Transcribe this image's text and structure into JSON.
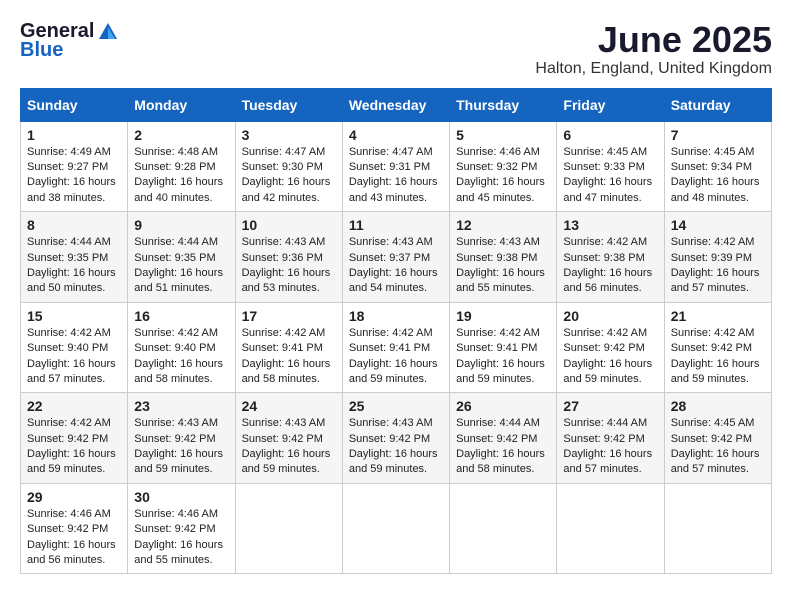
{
  "logo": {
    "general": "General",
    "blue": "Blue"
  },
  "title": "June 2025",
  "location": "Halton, England, United Kingdom",
  "headers": [
    "Sunday",
    "Monday",
    "Tuesday",
    "Wednesday",
    "Thursday",
    "Friday",
    "Saturday"
  ],
  "weeks": [
    [
      {
        "day": "1",
        "sunrise": "Sunrise: 4:49 AM",
        "sunset": "Sunset: 9:27 PM",
        "daylight": "Daylight: 16 hours and 38 minutes."
      },
      {
        "day": "2",
        "sunrise": "Sunrise: 4:48 AM",
        "sunset": "Sunset: 9:28 PM",
        "daylight": "Daylight: 16 hours and 40 minutes."
      },
      {
        "day": "3",
        "sunrise": "Sunrise: 4:47 AM",
        "sunset": "Sunset: 9:30 PM",
        "daylight": "Daylight: 16 hours and 42 minutes."
      },
      {
        "day": "4",
        "sunrise": "Sunrise: 4:47 AM",
        "sunset": "Sunset: 9:31 PM",
        "daylight": "Daylight: 16 hours and 43 minutes."
      },
      {
        "day": "5",
        "sunrise": "Sunrise: 4:46 AM",
        "sunset": "Sunset: 9:32 PM",
        "daylight": "Daylight: 16 hours and 45 minutes."
      },
      {
        "day": "6",
        "sunrise": "Sunrise: 4:45 AM",
        "sunset": "Sunset: 9:33 PM",
        "daylight": "Daylight: 16 hours and 47 minutes."
      },
      {
        "day": "7",
        "sunrise": "Sunrise: 4:45 AM",
        "sunset": "Sunset: 9:34 PM",
        "daylight": "Daylight: 16 hours and 48 minutes."
      }
    ],
    [
      {
        "day": "8",
        "sunrise": "Sunrise: 4:44 AM",
        "sunset": "Sunset: 9:35 PM",
        "daylight": "Daylight: 16 hours and 50 minutes."
      },
      {
        "day": "9",
        "sunrise": "Sunrise: 4:44 AM",
        "sunset": "Sunset: 9:35 PM",
        "daylight": "Daylight: 16 hours and 51 minutes."
      },
      {
        "day": "10",
        "sunrise": "Sunrise: 4:43 AM",
        "sunset": "Sunset: 9:36 PM",
        "daylight": "Daylight: 16 hours and 53 minutes."
      },
      {
        "day": "11",
        "sunrise": "Sunrise: 4:43 AM",
        "sunset": "Sunset: 9:37 PM",
        "daylight": "Daylight: 16 hours and 54 minutes."
      },
      {
        "day": "12",
        "sunrise": "Sunrise: 4:43 AM",
        "sunset": "Sunset: 9:38 PM",
        "daylight": "Daylight: 16 hours and 55 minutes."
      },
      {
        "day": "13",
        "sunrise": "Sunrise: 4:42 AM",
        "sunset": "Sunset: 9:38 PM",
        "daylight": "Daylight: 16 hours and 56 minutes."
      },
      {
        "day": "14",
        "sunrise": "Sunrise: 4:42 AM",
        "sunset": "Sunset: 9:39 PM",
        "daylight": "Daylight: 16 hours and 57 minutes."
      }
    ],
    [
      {
        "day": "15",
        "sunrise": "Sunrise: 4:42 AM",
        "sunset": "Sunset: 9:40 PM",
        "daylight": "Daylight: 16 hours and 57 minutes."
      },
      {
        "day": "16",
        "sunrise": "Sunrise: 4:42 AM",
        "sunset": "Sunset: 9:40 PM",
        "daylight": "Daylight: 16 hours and 58 minutes."
      },
      {
        "day": "17",
        "sunrise": "Sunrise: 4:42 AM",
        "sunset": "Sunset: 9:41 PM",
        "daylight": "Daylight: 16 hours and 58 minutes."
      },
      {
        "day": "18",
        "sunrise": "Sunrise: 4:42 AM",
        "sunset": "Sunset: 9:41 PM",
        "daylight": "Daylight: 16 hours and 59 minutes."
      },
      {
        "day": "19",
        "sunrise": "Sunrise: 4:42 AM",
        "sunset": "Sunset: 9:41 PM",
        "daylight": "Daylight: 16 hours and 59 minutes."
      },
      {
        "day": "20",
        "sunrise": "Sunrise: 4:42 AM",
        "sunset": "Sunset: 9:42 PM",
        "daylight": "Daylight: 16 hours and 59 minutes."
      },
      {
        "day": "21",
        "sunrise": "Sunrise: 4:42 AM",
        "sunset": "Sunset: 9:42 PM",
        "daylight": "Daylight: 16 hours and 59 minutes."
      }
    ],
    [
      {
        "day": "22",
        "sunrise": "Sunrise: 4:42 AM",
        "sunset": "Sunset: 9:42 PM",
        "daylight": "Daylight: 16 hours and 59 minutes."
      },
      {
        "day": "23",
        "sunrise": "Sunrise: 4:43 AM",
        "sunset": "Sunset: 9:42 PM",
        "daylight": "Daylight: 16 hours and 59 minutes."
      },
      {
        "day": "24",
        "sunrise": "Sunrise: 4:43 AM",
        "sunset": "Sunset: 9:42 PM",
        "daylight": "Daylight: 16 hours and 59 minutes."
      },
      {
        "day": "25",
        "sunrise": "Sunrise: 4:43 AM",
        "sunset": "Sunset: 9:42 PM",
        "daylight": "Daylight: 16 hours and 59 minutes."
      },
      {
        "day": "26",
        "sunrise": "Sunrise: 4:44 AM",
        "sunset": "Sunset: 9:42 PM",
        "daylight": "Daylight: 16 hours and 58 minutes."
      },
      {
        "day": "27",
        "sunrise": "Sunrise: 4:44 AM",
        "sunset": "Sunset: 9:42 PM",
        "daylight": "Daylight: 16 hours and 57 minutes."
      },
      {
        "day": "28",
        "sunrise": "Sunrise: 4:45 AM",
        "sunset": "Sunset: 9:42 PM",
        "daylight": "Daylight: 16 hours and 57 minutes."
      }
    ],
    [
      {
        "day": "29",
        "sunrise": "Sunrise: 4:46 AM",
        "sunset": "Sunset: 9:42 PM",
        "daylight": "Daylight: 16 hours and 56 minutes."
      },
      {
        "day": "30",
        "sunrise": "Sunrise: 4:46 AM",
        "sunset": "Sunset: 9:42 PM",
        "daylight": "Daylight: 16 hours and 55 minutes."
      },
      null,
      null,
      null,
      null,
      null
    ]
  ]
}
